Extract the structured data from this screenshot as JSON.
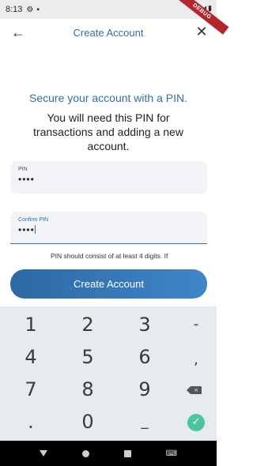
{
  "status_bar": {
    "time": "8:13",
    "debug_label": "DEBUG"
  },
  "app_bar": {
    "title": "Create Account",
    "back_icon": "arrow-left-icon",
    "close_icon": "close-icon"
  },
  "content": {
    "heading": "Secure your account with a PIN.",
    "subtext": "You will need this PIN for transactions and adding a new account.",
    "pin_field": {
      "label": "PIN",
      "value": "••••"
    },
    "confirm_field": {
      "label": "Confirm PIN",
      "value": "••••"
    },
    "hint": "PIN should consist of at least 4 digits. If",
    "create_button": "Create Account"
  },
  "keypad": {
    "keys": [
      "1",
      "2",
      "3",
      "-",
      "4",
      "5",
      "6",
      ",",
      "7",
      "8",
      "9",
      "⌫",
      ".",
      "0",
      "_",
      "✓"
    ]
  },
  "colors": {
    "accent": "#2f6fa8",
    "button_start": "#2d69a3",
    "button_end": "#3f86c8",
    "keypad_bg": "#e7eaee",
    "done_key": "#49c79a"
  }
}
